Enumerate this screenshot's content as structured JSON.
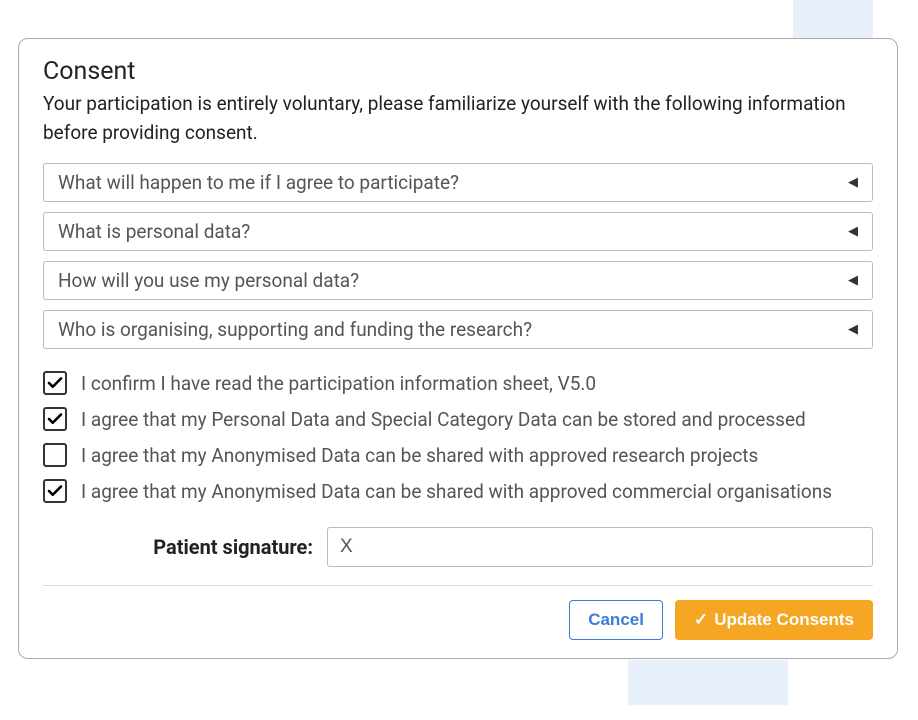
{
  "title": "Consent",
  "subtitle": "Your participation is entirely voluntary, please familiarize yourself with the following information before providing consent.",
  "accordions": [
    {
      "label": "What will happen to me if I agree to participate?"
    },
    {
      "label": "What is personal data?"
    },
    {
      "label": "How will you use my personal data?"
    },
    {
      "label": "Who is organising, supporting and funding the research?"
    }
  ],
  "consents": [
    {
      "label": "I confirm I have read the participation information sheet, V5.0",
      "checked": true
    },
    {
      "label": "I agree that my Personal Data and Special Category Data can be stored and processed",
      "checked": true
    },
    {
      "label": "I agree that my Anonymised Data can be shared with approved research projects",
      "checked": false
    },
    {
      "label": "I agree that my Anonymised Data can be shared with approved commercial organisations",
      "checked": true
    }
  ],
  "signature": {
    "label": "Patient signature:",
    "value": "X"
  },
  "buttons": {
    "cancel": "Cancel",
    "update": "Update Consents"
  }
}
